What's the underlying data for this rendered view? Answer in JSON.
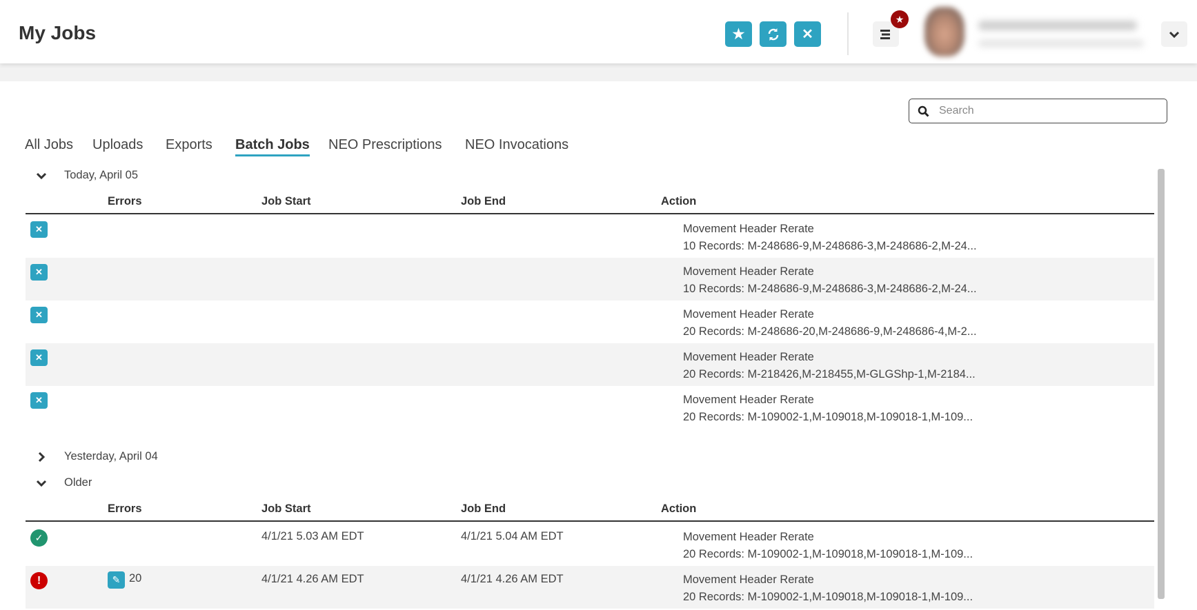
{
  "header": {
    "title": "My Jobs",
    "notification_badge_icon": "star-icon"
  },
  "search": {
    "placeholder": "Search",
    "value": ""
  },
  "tabs": [
    {
      "label": "All Jobs",
      "active": false
    },
    {
      "label": "Uploads",
      "active": false
    },
    {
      "label": "Exports",
      "active": false
    },
    {
      "label": "Batch Jobs",
      "active": true
    },
    {
      "label": "NEO Prescriptions",
      "active": false
    },
    {
      "label": "NEO Invocations",
      "active": false
    }
  ],
  "columns": {
    "errors": "Errors",
    "job_start": "Job Start",
    "job_end": "Job End",
    "action": "Action"
  },
  "groups": {
    "today": {
      "label": "Today, April 05",
      "expanded": true,
      "rows": [
        {
          "status": "cancel",
          "action_title": "Movement Header Rerate",
          "action_detail": "10 Records: M-248686-9,M-248686-3,M-248686-2,M-24..."
        },
        {
          "status": "cancel",
          "action_title": "Movement Header Rerate",
          "action_detail": "10 Records: M-248686-9,M-248686-3,M-248686-2,M-24..."
        },
        {
          "status": "cancel",
          "action_title": "Movement Header Rerate",
          "action_detail": "20 Records: M-248686-20,M-248686-9,M-248686-4,M-2..."
        },
        {
          "status": "cancel",
          "action_title": "Movement Header Rerate",
          "action_detail": "20 Records: M-218426,M-218455,M-GLGShp-1,M-2184..."
        },
        {
          "status": "cancel",
          "action_title": "Movement Header Rerate",
          "action_detail": "20 Records: M-109002-1,M-109018,M-109018-1,M-109..."
        }
      ]
    },
    "yesterday": {
      "label": "Yesterday, April 04",
      "expanded": false
    },
    "older": {
      "label": "Older",
      "expanded": true,
      "rows": [
        {
          "status": "success",
          "errors": "",
          "job_start": "4/1/21 5.03 AM EDT",
          "job_end": "4/1/21 5.04 AM EDT",
          "action_title": "Movement Header Rerate",
          "action_detail": "20 Records: M-109002-1,M-109018,M-109018-1,M-109..."
        },
        {
          "status": "error",
          "errors": "20",
          "job_start": "4/1/21 4.26 AM EDT",
          "job_end": "4/1/21 4.26 AM EDT",
          "action_title": "Movement Header Rerate",
          "action_detail": "20 Records: M-109002-1,M-109018,M-109018-1,M-109..."
        }
      ]
    }
  },
  "colors": {
    "accent": "#2ea3c1",
    "success": "#21956f",
    "error": "#cc0000",
    "badge": "#9b0a0a"
  }
}
